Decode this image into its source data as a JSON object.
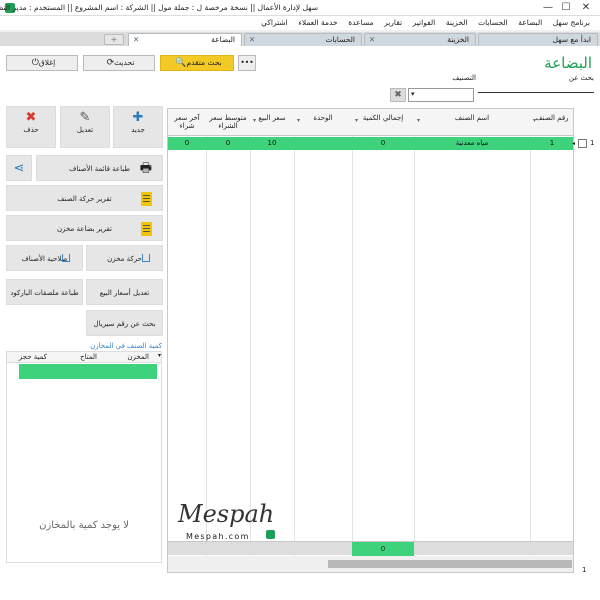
{
  "window": {
    "title": "سهل لإدارة الأعمال   ||   نسخة مرخصة ل : جملة مول   ||   الشركة : اسم المشروع   ||   المستخدم : مدير النظام"
  },
  "menu": [
    "برنامج سهل",
    "البضاعة",
    "الحسابات",
    "الخزينة",
    "الفواتير",
    "تقارير",
    "مساعدة",
    "خدمة العملاء",
    "اشتراكي"
  ],
  "tabs": [
    {
      "label": "ابدأ مع سهل"
    },
    {
      "label": "الخزينة"
    },
    {
      "label": "الحسابات"
    },
    {
      "label": "البضاعة"
    }
  ],
  "toolbar": {
    "advanced_search": "بحث متقدم",
    "refresh": "تحديث",
    "close": "إغلاق"
  },
  "page": {
    "title": "البضاعة",
    "search_label": "بحث عن",
    "category_label": "التصنيف"
  },
  "grid": {
    "headers": [
      "رقم الصنف",
      "اسم الصنف",
      "إجمالي الكمية",
      "الوحدة",
      "سعر البيع",
      "متوسط سعر الشراء",
      "آخر سعر شراء"
    ],
    "row_number": "1",
    "footer_row_number": "1",
    "rows": [
      {
        "id": "1",
        "name": "مياه معدنية",
        "qty": "0",
        "unit": "",
        "sale": "10",
        "avg_buy": "0",
        "last_buy": "0"
      }
    ],
    "footer_total_qty": "0"
  },
  "side": {
    "new": "جديد",
    "edit": "تعديل",
    "delete": "حذف",
    "print_list": "طباعة قائمة الأصناف",
    "item_movement": "تقرير حركة الصنف",
    "stock_report": "تقرير بضاعة مخزن",
    "store_movement": "حركة مخزن",
    "validity": "صلاحية الأصناف",
    "barcode": "طباعة ملصقات الباركود",
    "edit_prices": "تعديل أسعار البيع",
    "serial_search": "بحث عن رقم سيريال"
  },
  "stock": {
    "link": "كمية الصنف في المخازن",
    "headers": [
      "المخزن",
      "المتاح",
      "كمية حجز"
    ],
    "empty": "لا يوجد كمية بالمخازن"
  },
  "watermark": {
    "url": "Mespah.com"
  }
}
